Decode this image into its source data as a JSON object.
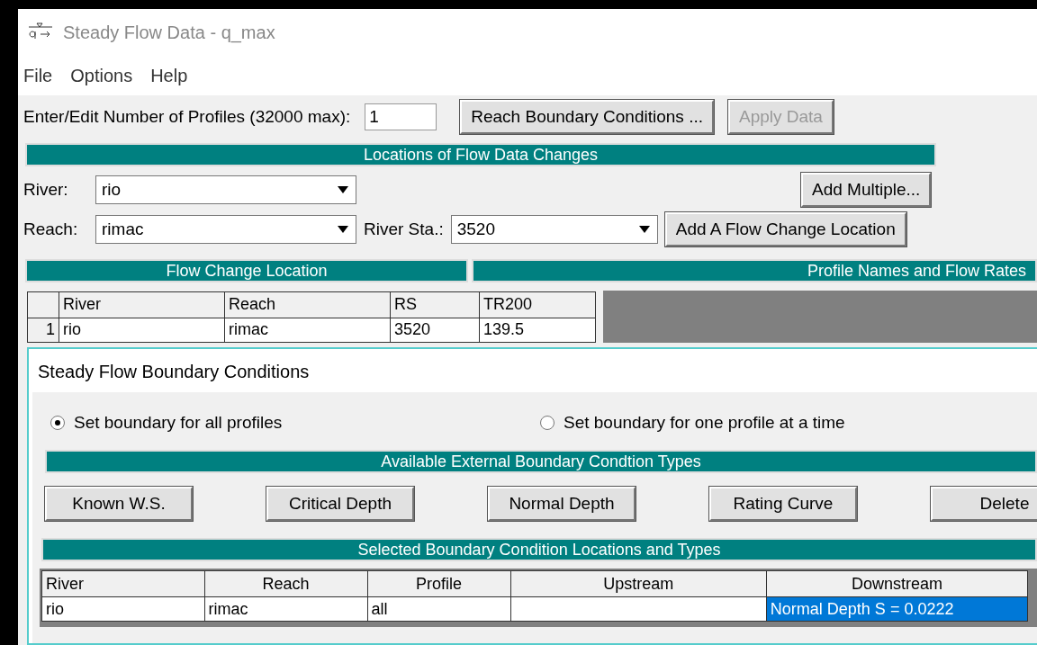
{
  "window": {
    "title": "Steady Flow Data - q_max"
  },
  "menu": [
    {
      "label": "File"
    },
    {
      "label": "Options"
    },
    {
      "label": "Help"
    }
  ],
  "profiles": {
    "label": "Enter/Edit Number of Profiles (32000 max):",
    "value": "1"
  },
  "top_buttons": [
    {
      "label": "Reach Boundary Conditions ...",
      "disabled": false
    },
    {
      "label": "Apply Data",
      "disabled": true
    }
  ],
  "locations": {
    "header": "Locations of Flow Data Changes",
    "river": {
      "label": "River:",
      "value": "rio"
    },
    "reach": {
      "label": "Reach:",
      "value": "rimac"
    },
    "river_sta": {
      "label": "River Sta.:",
      "value": "3520"
    },
    "add_multiple": "Add Multiple...",
    "add_location": "Add A Flow Change Location"
  },
  "flow_table": {
    "left_header": "Flow Change Location",
    "right_header": "Profile Names and Flow Rates",
    "columns": [
      "River",
      "Reach",
      "RS",
      "TR200"
    ],
    "rows": [
      {
        "number": "1",
        "cells": [
          "rio",
          "rimac",
          "3520",
          "139.5"
        ]
      }
    ]
  },
  "dialog": {
    "title": "Steady Flow Boundary Conditions",
    "radios": [
      {
        "label": "Set boundary for all profiles",
        "selected": true
      },
      {
        "label": "Set boundary for one profile at a time",
        "selected": false
      }
    ],
    "types_header": "Available External Boundary Condtion Types",
    "type_buttons": [
      "Known W.S.",
      "Critical Depth",
      "Normal Depth",
      "Rating Curve",
      "Delete"
    ],
    "locations_header": "Selected Boundary Condition Locations and Types",
    "columns": [
      "River",
      "Reach",
      "Profile",
      "Upstream",
      "Downstream"
    ],
    "rows": [
      {
        "cells": [
          {
            "text": "rio",
            "selected": false
          },
          {
            "text": "rimac",
            "selected": false
          },
          {
            "text": "all",
            "selected": false
          },
          {
            "text": "",
            "selected": false
          },
          {
            "text": "Normal Depth S = 0.0222",
            "selected": true
          }
        ]
      }
    ]
  }
}
